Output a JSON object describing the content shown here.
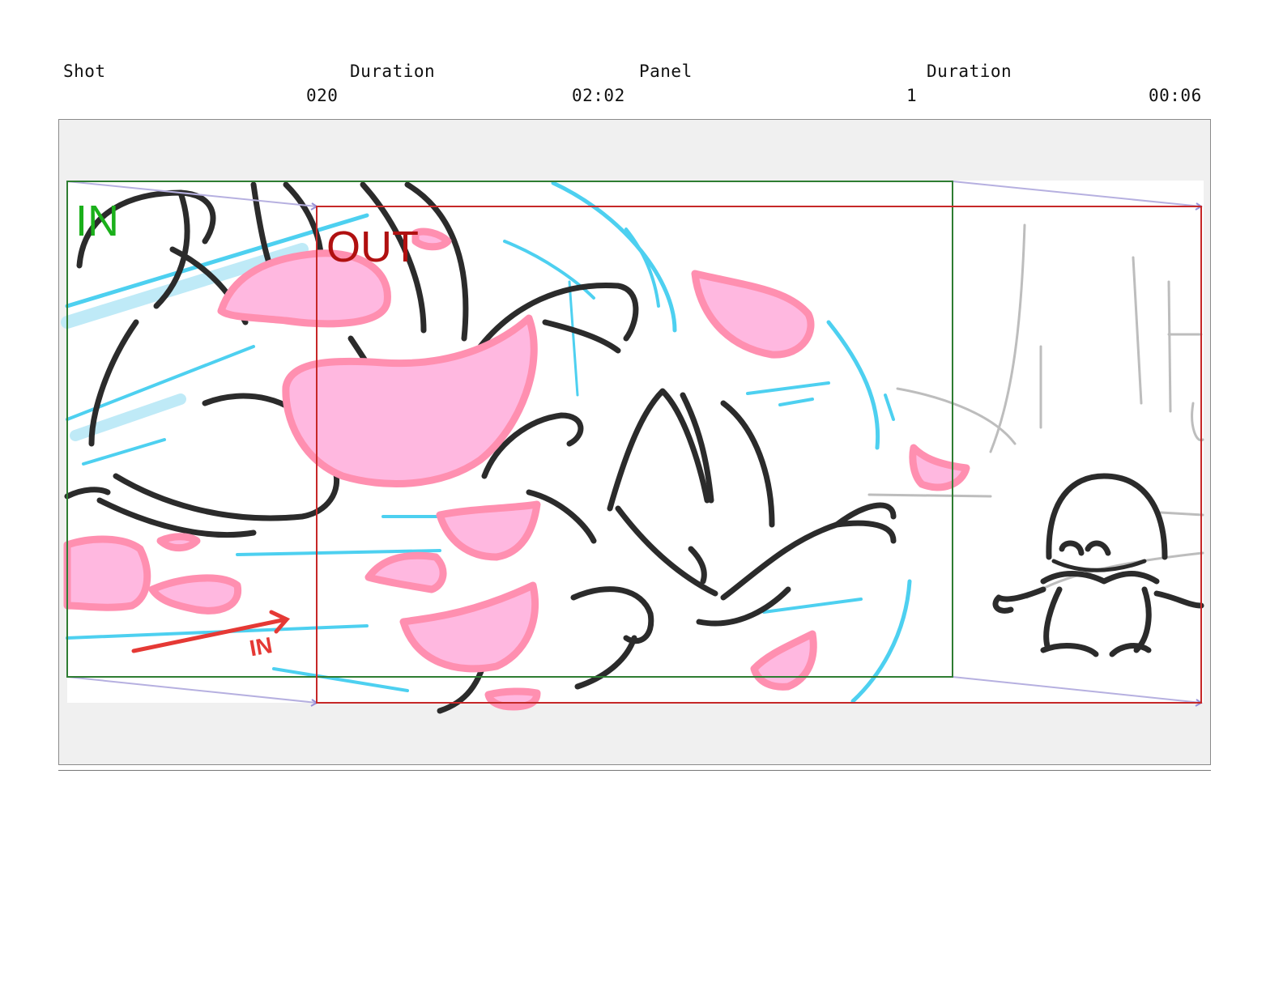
{
  "header": {
    "shot_label": "Shot",
    "shot_value": "020",
    "shot_duration_label": "Duration",
    "shot_duration_value": "02:02",
    "panel_label": "Panel",
    "panel_value": "1",
    "panel_duration_label": "Duration",
    "panel_duration_value": "00:06"
  },
  "camera": {
    "in_label": "IN",
    "out_label": "OUT",
    "handwritten_note": "IN",
    "in_frame_color": "#2e7d32",
    "out_frame_color": "#c62828",
    "motion_arrow_color": "#e53935"
  },
  "colors": {
    "petal_fill": "#ffb8e0",
    "petal_stroke": "#ff8fb0",
    "speed_line": "#4dd0f0",
    "ink": "#2b2b2b",
    "background_sketch": "#bdbdbd",
    "panel_background": "#f0f0f0"
  }
}
